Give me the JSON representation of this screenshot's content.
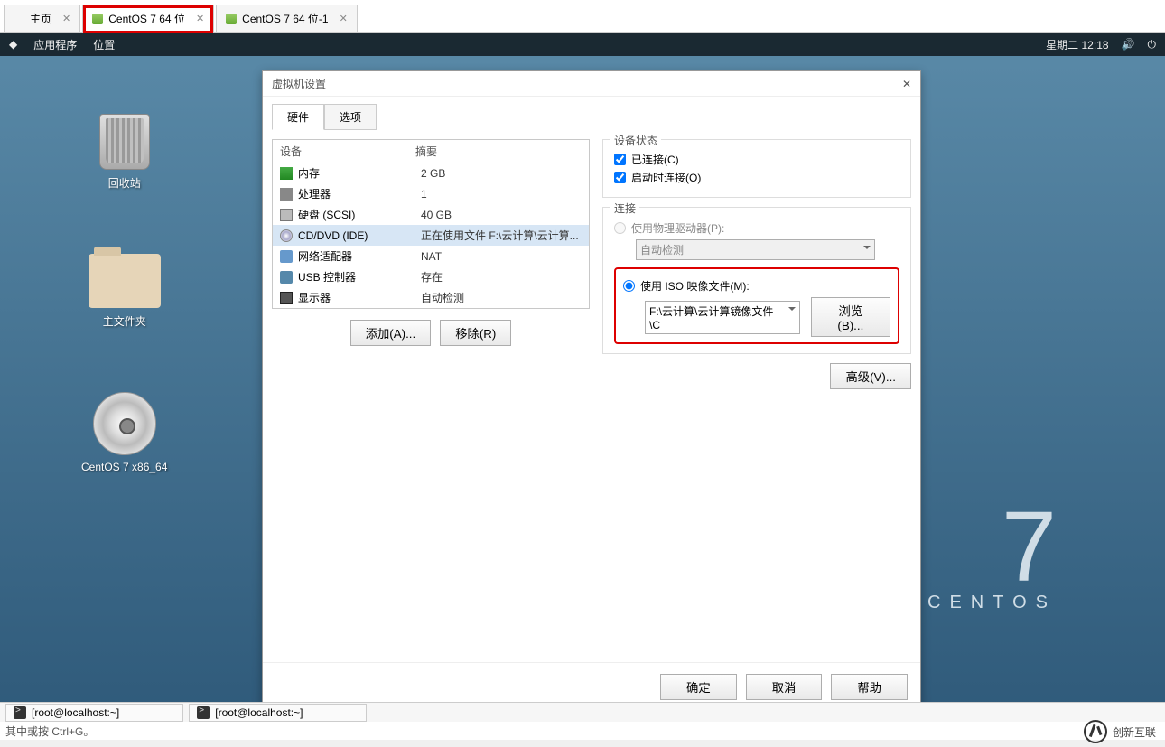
{
  "tabs": {
    "home": "主页",
    "vm1": "CentOS 7 64 位",
    "vm2": "CentOS 7 64 位-1"
  },
  "gnome": {
    "apps": "应用程序",
    "places": "位置",
    "datetime": "星期二 12:18"
  },
  "desktop_icons": {
    "trash": "回收站",
    "home": "主文件夹",
    "cdrom": "CentOS 7 x86_64"
  },
  "centos": {
    "seven": "7",
    "name": "CENTOS"
  },
  "dialog": {
    "title": "虚拟机设置",
    "tab_hw": "硬件",
    "tab_opt": "选项",
    "col_device": "设备",
    "col_summary": "摘要",
    "hw": [
      {
        "icon": "ic-mem",
        "name": "内存",
        "summary": "2 GB"
      },
      {
        "icon": "ic-cpu",
        "name": "处理器",
        "summary": "1"
      },
      {
        "icon": "ic-hdd",
        "name": "硬盘 (SCSI)",
        "summary": "40 GB"
      },
      {
        "icon": "ic-cd",
        "name": "CD/DVD (IDE)",
        "summary": "正在使用文件 F:\\云计算\\云计算...",
        "selected": true
      },
      {
        "icon": "ic-net",
        "name": "网络适配器",
        "summary": "NAT"
      },
      {
        "icon": "ic-usb",
        "name": "USB 控制器",
        "summary": "存在"
      },
      {
        "icon": "ic-mon",
        "name": "显示器",
        "summary": "自动检测"
      }
    ],
    "btn_add": "添加(A)...",
    "btn_remove": "移除(R)",
    "grp_status": "设备状态",
    "chk_connected": "已连接(C)",
    "chk_connect_start": "启动时连接(O)",
    "grp_connection": "连接",
    "radio_physical": "使用物理驱动器(P):",
    "physical_value": "自动检测",
    "radio_iso": "使用 ISO 映像文件(M):",
    "iso_value": "F:\\云计算\\云计算镜像文件\\C",
    "btn_browse": "浏览(B)...",
    "btn_advanced": "高级(V)...",
    "btn_ok": "确定",
    "btn_cancel": "取消",
    "btn_help": "帮助"
  },
  "taskbar": {
    "term1": "[root@localhost:~]",
    "term2": "[root@localhost:~]"
  },
  "status_text": "其中或按 Ctrl+G。",
  "brand": "创新互联"
}
